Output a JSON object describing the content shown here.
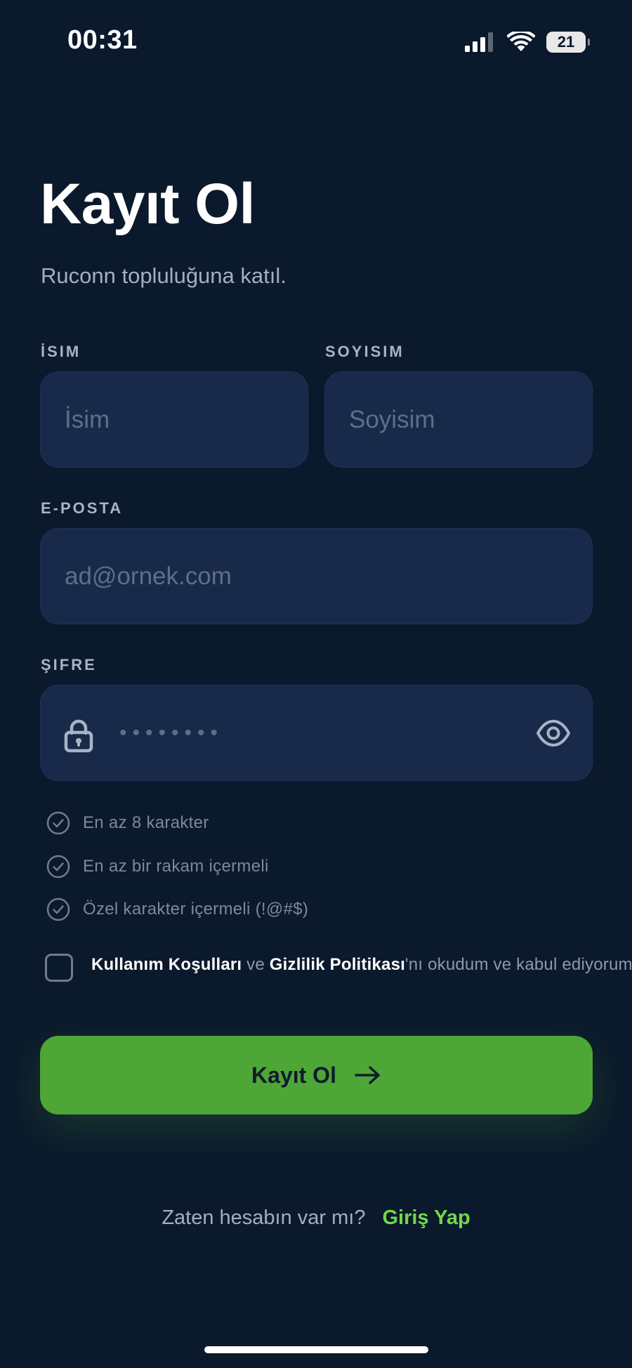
{
  "status_bar": {
    "time": "00:31",
    "battery": "21"
  },
  "header": {
    "title": "Kayıt Ol",
    "subtitle": "Ruconn topluluğuna katıl."
  },
  "form": {
    "first_name": {
      "label": "İSIM",
      "placeholder": "İsim",
      "value": ""
    },
    "last_name": {
      "label": "SOYISIM",
      "placeholder": "Soyisim",
      "value": ""
    },
    "email": {
      "label": "E-POSTA",
      "placeholder": "ad@ornek.com",
      "value": ""
    },
    "password": {
      "label": "ŞIFRE",
      "placeholder": "••••••••",
      "value": ""
    },
    "requirements": [
      "En az 8 karakter",
      "En az bir rakam içermeli",
      "Özel karakter içermeli (!@#$)"
    ],
    "terms": {
      "checked": false,
      "terms_link": "Kullanım Koşulları",
      "connector": " ve ",
      "privacy_link": "Gizlilik Politikası",
      "suffix": "'nı okudum ve kabul ediyorum."
    },
    "submit_label": "Kayıt Ol"
  },
  "footer": {
    "question": "Zaten hesabın var mı?",
    "login_link": "Giriş Yap"
  },
  "colors": {
    "background": "#0b192c",
    "field_background": "#18294a",
    "accent_green": "#4ea636",
    "link_green": "#72d84a"
  },
  "icons": {
    "lock": "lock-icon",
    "eye": "eye-icon",
    "check": "check-circle-icon",
    "arrow": "arrow-right-icon",
    "signal": "cellular-signal-icon",
    "wifi": "wifi-icon",
    "battery": "battery-icon"
  }
}
